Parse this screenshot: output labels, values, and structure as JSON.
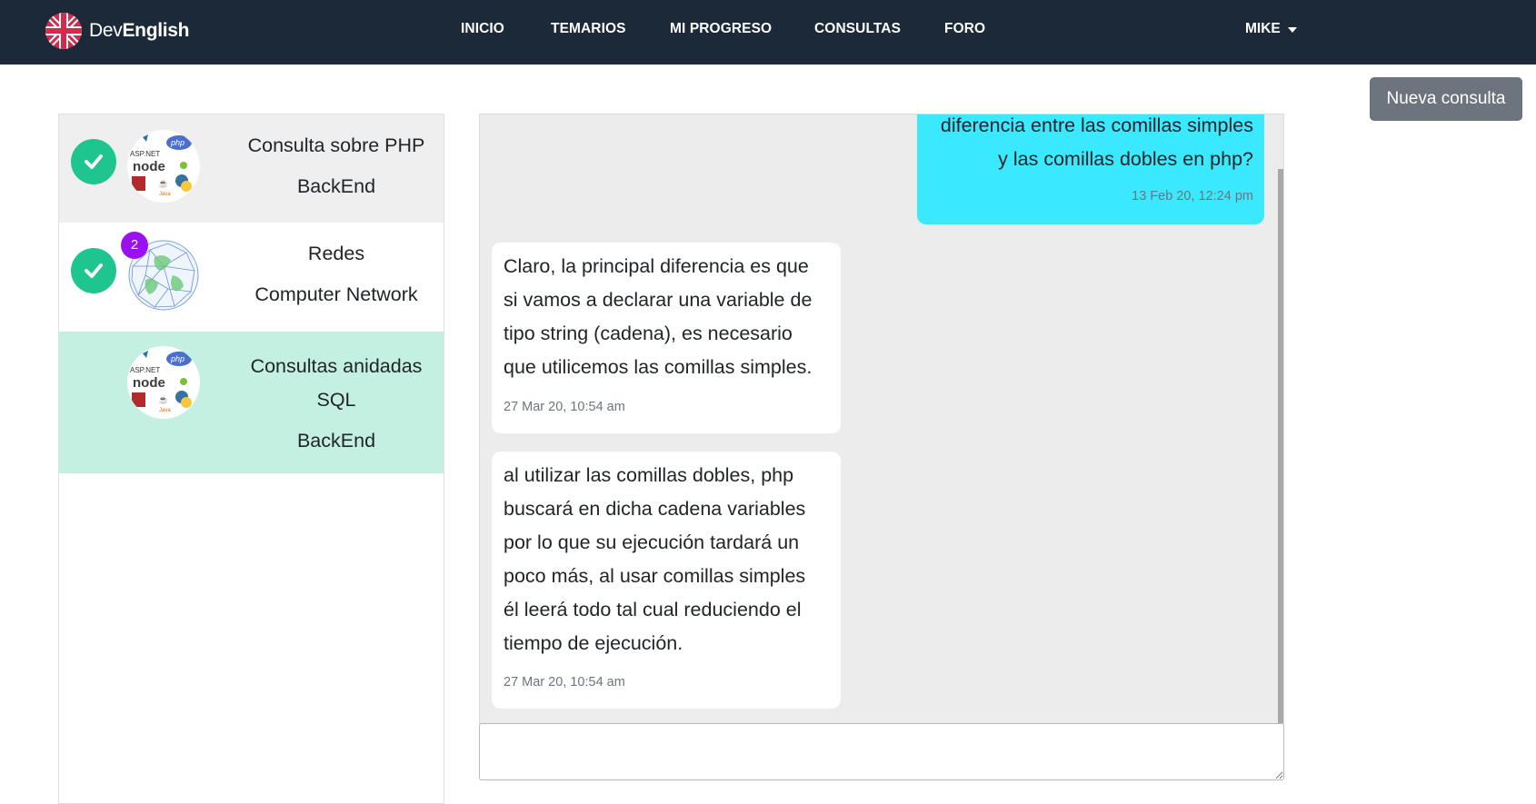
{
  "brand": {
    "part1": "Dev",
    "part2": "English",
    "icon": "uk-flag-icon"
  },
  "nav": {
    "items": [
      {
        "label": "INICIO"
      },
      {
        "label": "TEMARIOS"
      },
      {
        "label": "MI PROGRESO"
      },
      {
        "label": "CONSULTAS"
      },
      {
        "label": "FORO"
      }
    ],
    "user": "MIKE"
  },
  "new_query_label": "Nueva consulta",
  "conversations": [
    {
      "title": "Consulta sobre PHP",
      "category": "BackEnd",
      "resolved": true,
      "avatar": "backend-logos-icon",
      "active": false
    },
    {
      "title": "Redes",
      "category": "Computer Network",
      "resolved": true,
      "avatar": "network-globe-icon",
      "unread": "2",
      "active": false
    },
    {
      "title": "Consultas anidadas SQL",
      "category": "BackEnd",
      "resolved": false,
      "avatar": "backend-logos-icon",
      "active": true
    }
  ],
  "messages": [
    {
      "direction": "out",
      "lines": [
        "diferencia entre las comillas simples",
        "y las comillas dobles en php?"
      ],
      "time": "13 Feb 20, 12:24 pm"
    },
    {
      "direction": "in",
      "lines": [
        "Claro, la principal diferencia es que",
        "si vamos a declarar una variable de",
        "tipo string (cadena), es necesario",
        "que utilicemos las comillas simples."
      ],
      "time": "27 Mar 20, 10:54 am"
    },
    {
      "direction": "in",
      "lines": [
        "al utilizar las comillas dobles, php",
        "buscará en dicha cadena variables",
        "por lo que su ejecución tardará un",
        "poco más, al usar comillas simples",
        "él leerá todo tal cual reduciendo el",
        "tiempo de ejecución."
      ],
      "time": "27 Mar 20, 10:54 am"
    }
  ],
  "message_input": {
    "placeholder": ""
  },
  "colors": {
    "navbar": "#1c2939",
    "resolved_check": "#1fc58f",
    "badge": "#9b10ee",
    "active_conversation": "#c4f0e2",
    "selected_conversation": "#efefef",
    "outgoing_bubble": "#3ae9fd",
    "chat_background": "#ececec",
    "button_secondary": "#6c757d"
  }
}
